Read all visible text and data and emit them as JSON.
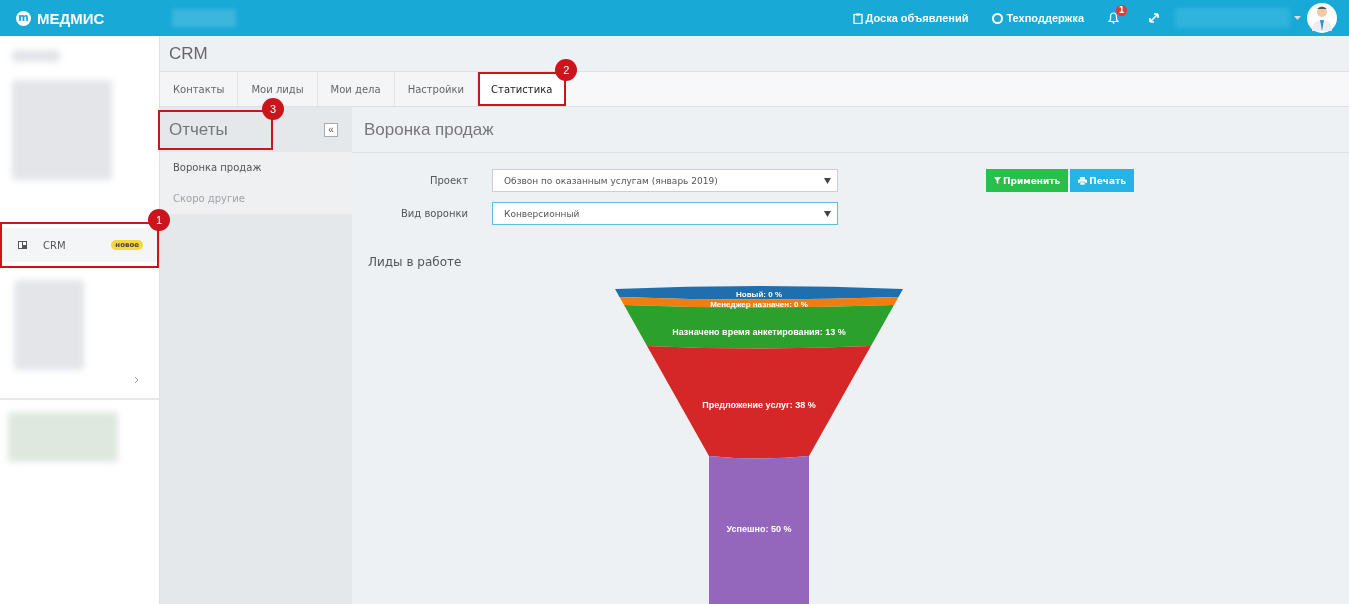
{
  "topbar": {
    "logo_mark": "m",
    "logo": "МЕДМИС",
    "links": [
      {
        "label": "Доска объявлений",
        "kind": "board"
      },
      {
        "label": "Техподдержка",
        "kind": "support"
      }
    ],
    "notification_count": "1"
  },
  "sidebar": {
    "items": [
      {
        "label": "CRM",
        "badge": "новое",
        "callout": "1"
      }
    ]
  },
  "page": {
    "title": "CRM"
  },
  "tabs": [
    {
      "label": "Контакты",
      "selected": false
    },
    {
      "label": "Мои лиды",
      "selected": false
    },
    {
      "label": "Мои дела",
      "selected": false
    },
    {
      "label": "Настройки",
      "selected": false
    },
    {
      "label": "Статистика",
      "selected": true,
      "callout": "2"
    }
  ],
  "reports": {
    "title": "Отчеты",
    "callout": "3",
    "collapse": "«",
    "items": [
      {
        "label": "Воронка продаж",
        "disabled": false
      },
      {
        "label": "Скоро другие",
        "disabled": true
      }
    ]
  },
  "report": {
    "title": "Воронка продаж",
    "fields": [
      {
        "label": "Проект",
        "value": "Обзвон по оказанным услугам (январь 2019)",
        "focused": false
      },
      {
        "label": "Вид воронки",
        "value": "Конверсионный",
        "focused": true
      }
    ],
    "buttons": [
      {
        "label": "Применить",
        "kind": "apply"
      },
      {
        "label": "Печать",
        "kind": "print"
      }
    ],
    "section_title": "Лиды в работе",
    "funnel": [
      {
        "label": "Новый: 0 %",
        "color": "#1f6fae"
      },
      {
        "label": "Менеджер назначен: 0 %",
        "color": "#ef7d10"
      },
      {
        "label": "Назначено время анкетирования: 13 %",
        "color": "#2ca02c"
      },
      {
        "label": "Предложение услуг: 38 %",
        "color": "#d62728"
      },
      {
        "label": "Успешно: 50 %",
        "color": "#9467bd"
      }
    ]
  }
}
